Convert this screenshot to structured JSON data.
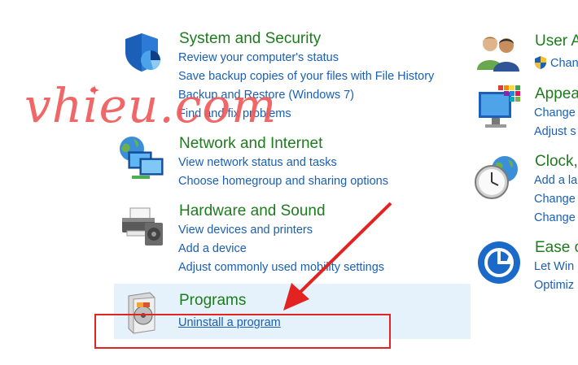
{
  "left_column": {
    "system_security": {
      "title": "System and Security",
      "links": [
        "Review your computer's status",
        "Save backup copies of your files with File History",
        "Backup and Restore (Windows 7)",
        "Find and fix problems"
      ]
    },
    "network": {
      "title": "Network and Internet",
      "links": [
        "View network status and tasks",
        "Choose homegroup and sharing options"
      ]
    },
    "hardware": {
      "title": "Hardware and Sound",
      "links": [
        "View devices and printers",
        "Add a device",
        "Adjust commonly used mobility settings"
      ]
    },
    "programs": {
      "title": "Programs",
      "links": [
        "Uninstall a program"
      ]
    }
  },
  "right_column": {
    "user_accounts": {
      "title": "User A",
      "links": [
        "Chan"
      ]
    },
    "appearance": {
      "title": "Appea",
      "links": [
        "Change",
        "Adjust s"
      ]
    },
    "clock": {
      "title": "Clock,",
      "links": [
        "Add a la",
        "Change",
        "Change"
      ]
    },
    "ease": {
      "title": "Ease o",
      "links": [
        "Let Win",
        "Optimiz"
      ]
    }
  },
  "watermark": {
    "text": "vhieu.com"
  },
  "colors": {
    "title_green": "#1e7b1e",
    "link_blue": "#1a5fb4",
    "annotation_red": "#e32222",
    "hover_bg": "#e5f1fb"
  }
}
